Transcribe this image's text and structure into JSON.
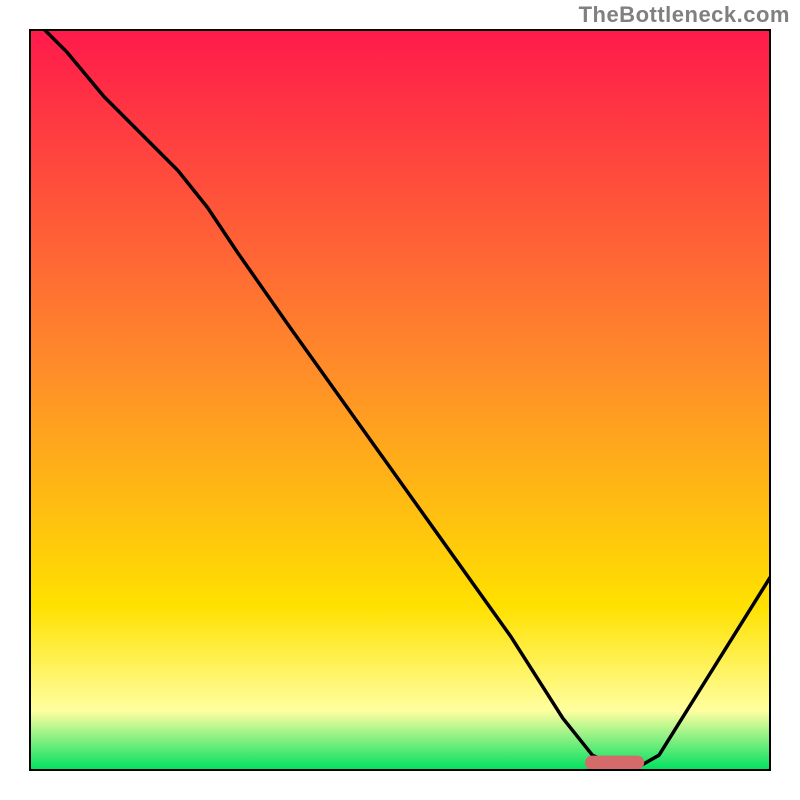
{
  "watermark": "TheBottleneck.com",
  "colors": {
    "gradient_top": "#ff1a4b",
    "gradient_mid": "#ffe100",
    "gradient_low": "#ffffa0",
    "gradient_bottom": "#00e060",
    "curve": "#000000",
    "frame": "#000000",
    "marker": "#d46a6a"
  },
  "chart_data": {
    "type": "line",
    "title": "",
    "xlabel": "",
    "ylabel": "",
    "xlim": [
      0,
      100
    ],
    "ylim": [
      0,
      100
    ],
    "x": [
      0,
      5,
      10,
      15,
      20,
      24,
      28,
      35,
      45,
      55,
      65,
      72,
      76,
      80,
      82,
      85,
      90,
      95,
      100
    ],
    "values": [
      102,
      97,
      91,
      86,
      81,
      76,
      70,
      60,
      46,
      32,
      18,
      7,
      2,
      0.2,
      0.3,
      2,
      10,
      18,
      26
    ],
    "optimal_marker": {
      "x_start": 75,
      "x_end": 83,
      "y": 1.0
    },
    "annotations": []
  }
}
